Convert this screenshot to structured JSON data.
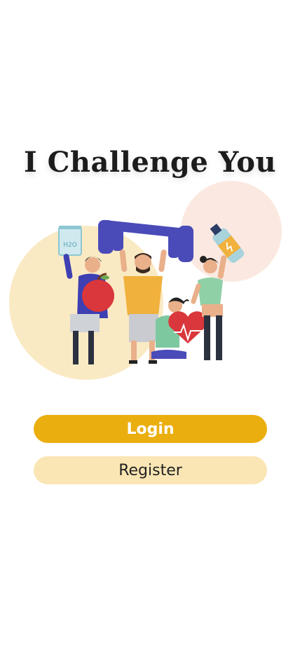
{
  "app": {
    "title": "I Challenge You"
  },
  "hero": {
    "illustration": "people-exercising-illustration",
    "cup_label": "H2O"
  },
  "actions": {
    "login_label": "Login",
    "register_label": "Register"
  },
  "colors": {
    "login_bg": "#eaae0f",
    "register_bg": "#fae6b4",
    "circle_yellow": "#faeac4",
    "circle_pink": "#fbe9e1",
    "dumbbell": "#4a4bb8"
  }
}
